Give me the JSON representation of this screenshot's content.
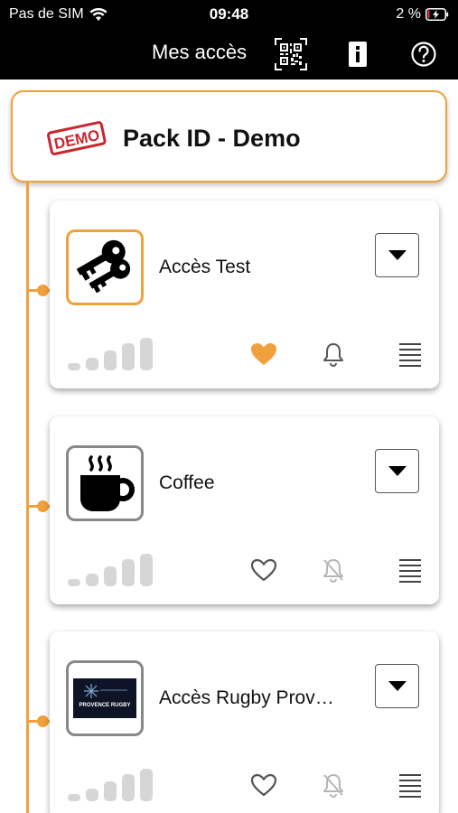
{
  "status": {
    "carrier": "Pas de SIM",
    "time": "09:48",
    "battery": "2 %"
  },
  "appbar": {
    "title": "Mes accès"
  },
  "pack": {
    "title": "Pack ID - Demo",
    "stamp_text": "DEMO"
  },
  "items": [
    {
      "label": "Accès Test",
      "icon": "key-icon",
      "favorite": true,
      "notifications": true,
      "active": true
    },
    {
      "label": "Coffee",
      "icon": "coffee-cup-icon",
      "favorite": false,
      "notifications": false,
      "active": false
    },
    {
      "label": "Accès Rugby Prov…",
      "icon": "rugby-logo-icon",
      "favorite": false,
      "notifications": false,
      "active": false,
      "logo_text": "PROVENCE RUGBY"
    }
  ],
  "colors": {
    "accent": "#f0a13b",
    "muted": "#d6d6d6"
  }
}
